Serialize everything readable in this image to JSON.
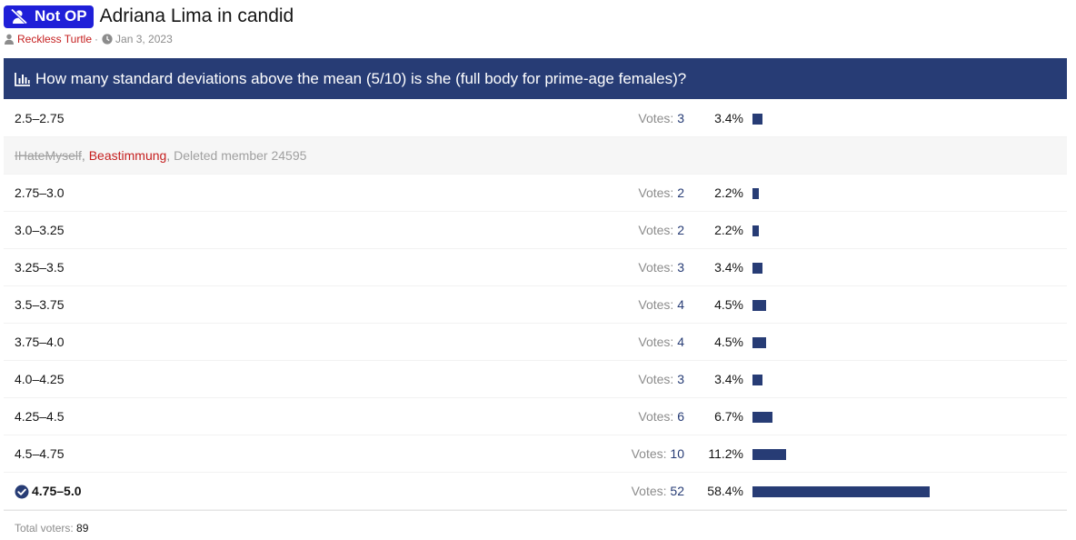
{
  "thread": {
    "prefix": "Not OP",
    "title": "Adriana Lima in candid",
    "author": "Reckless Turtle",
    "date": "Jan 3, 2023"
  },
  "poll": {
    "question": "How many standard deviations above the mean (5/10) is she (full body for prime-age females)?",
    "votes_prefix": "Votes: ",
    "options": [
      {
        "label": "2.5–2.75",
        "votes": "3",
        "percent": "3.4%",
        "share": 3.4
      },
      {
        "label": "2.75–3.0",
        "votes": "2",
        "percent": "2.2%",
        "share": 2.2
      },
      {
        "label": "3.0–3.25",
        "votes": "2",
        "percent": "2.2%",
        "share": 2.2
      },
      {
        "label": "3.25–3.5",
        "votes": "3",
        "percent": "3.4%",
        "share": 3.4
      },
      {
        "label": "3.5–3.75",
        "votes": "4",
        "percent": "4.5%",
        "share": 4.5
      },
      {
        "label": "3.75–4.0",
        "votes": "4",
        "percent": "4.5%",
        "share": 4.5
      },
      {
        "label": "4.0–4.25",
        "votes": "3",
        "percent": "3.4%",
        "share": 3.4
      },
      {
        "label": "4.25–4.5",
        "votes": "6",
        "percent": "6.7%",
        "share": 6.7
      },
      {
        "label": "4.5–4.75",
        "votes": "10",
        "percent": "11.2%",
        "share": 11.2
      },
      {
        "label": "4.75–5.0",
        "votes": "52",
        "percent": "58.4%",
        "share": 58.4
      }
    ],
    "voters": {
      "strike": "IHateMyself",
      "red": "Beastimmung",
      "deleted": "Deleted member 24595",
      "sep": ", "
    },
    "total_label": "Total voters: ",
    "total_value": "89"
  },
  "colors": {
    "accent": "#273c75",
    "badge": "#1f1fd8",
    "author": "#c51f1f"
  }
}
